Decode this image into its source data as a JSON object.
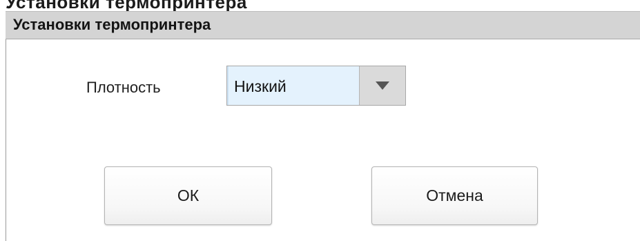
{
  "top_strip": {
    "text": "Установки термопринтера"
  },
  "dialog": {
    "title": "Установки термопринтера",
    "density": {
      "label": "Плотность",
      "selected_value": "Низкий",
      "arrow_icon": "triangle-down-icon"
    },
    "buttons": {
      "ok_label": "ОК",
      "cancel_label": "Отмена"
    }
  },
  "colors": {
    "title_bar": "#d4d4d4",
    "select_bg": "#e4f2fd",
    "arrow_btn": "#dadada",
    "arrow_glyph": "#555555"
  }
}
